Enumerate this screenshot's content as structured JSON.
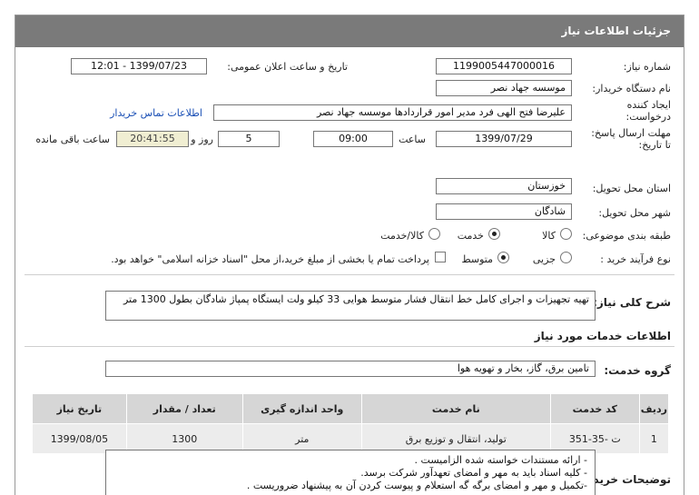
{
  "title": "جزئیات اطلاعات نیاز",
  "fields": {
    "need_number_label": "شماره نیاز:",
    "need_number": "1199005447000016",
    "announce_label": "تاریخ و ساعت اعلان عمومی:",
    "announce_value": "1399/07/23 - 12:01",
    "buyer_label": "نام دستگاه خریدار:",
    "buyer": "موسسه جهاد نصر",
    "creator_label": "ایجاد کننده درخواست:",
    "creator": "علیرضا فتح الهی فرد مدیر امور قراردادها موسسه جهاد نصر",
    "contact_link": "اطلاعات تماس خریدار",
    "deadline_label": "مهلت ارسال پاسخ: تا تاریخ:",
    "deadline_date": "1399/07/29",
    "time_label": "ساعت",
    "deadline_time": "09:00",
    "days_value": "5",
    "days_label": "روز و",
    "remaining_time": "20:41:55",
    "remaining_label": "ساعت باقی مانده",
    "province_label": "استان محل تحویل:",
    "province": "خوزستان",
    "city_label": "شهر محل تحویل:",
    "city": "شادگان",
    "category_label": "طبقه بندی موضوعی:",
    "category_options": [
      "کالا",
      "خدمت",
      "کالا/خدمت"
    ],
    "category_selected": "خدمت",
    "process_label": "نوع فرآیند خرید :",
    "process_options": [
      "جزیی",
      "متوسط"
    ],
    "process_selected": "متوسط",
    "payment_note": "پرداخت تمام یا بخشی از مبلغ خرید،از محل \"اسناد خزانه اسلامی\" خواهد بود."
  },
  "general_desc_label": "شرح کلی نیاز:",
  "general_desc": "تهیه تجهیزات و اجرای کامل خط انتقال فشار متوسط هوایی 33 کیلو ولت ایستگاه پمپاژ شادگان بطول 1300 متر",
  "services_heading": "اطلاعات خدمات مورد نیاز",
  "service_group_label": "گروه خدمت:",
  "service_group": "تامین برق، گاز، بخار و تهویه هوا",
  "table": {
    "headers": [
      "ردیف",
      "کد خدمت",
      "نام خدمت",
      "واحد اندازه گیری",
      "تعداد / مقدار",
      "تاریخ نیاز"
    ],
    "rows": [
      [
        "1",
        "ت -35-351",
        "تولید، انتقال و توزیع برق",
        "متر",
        "1300",
        "1399/08/05"
      ]
    ]
  },
  "buyer_notes_label": "توضیحات خریدار:",
  "buyer_notes": [
    "- ارائه مستندات خواسته شده الزامیست .",
    "- کلیه اسناد باید به مهر و امضای تعهدآور شرکت برسد.",
    "-تکمیل و مهر و امضای برگه گه استعلام و پیوست کردن آن به پیشنهاد ضروریست ."
  ]
}
